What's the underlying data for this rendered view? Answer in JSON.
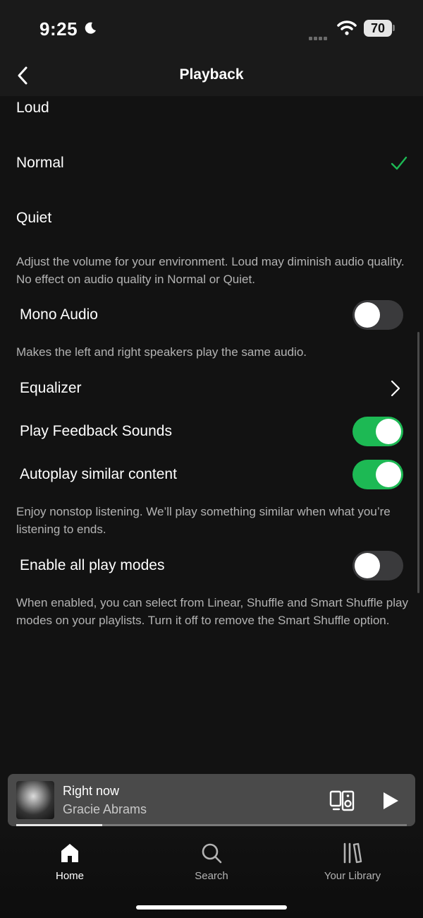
{
  "status_bar": {
    "time": "9:25",
    "battery": "70"
  },
  "header": {
    "title": "Playback"
  },
  "volume_level": {
    "options": [
      "Loud",
      "Normal",
      "Quiet"
    ],
    "selected": "Normal",
    "description": "Adjust the volume for your environment. Loud may diminish audio quality. No effect on audio quality in Normal or Quiet."
  },
  "settings": {
    "mono_audio": {
      "label": "Mono Audio",
      "enabled": false,
      "description": "Makes the left and right speakers play the same audio."
    },
    "equalizer": {
      "label": "Equalizer"
    },
    "play_feedback_sounds": {
      "label": "Play Feedback Sounds",
      "enabled": true
    },
    "autoplay": {
      "label": "Autoplay similar content",
      "enabled": true,
      "description": "Enjoy nonstop listening. We’ll play something similar when what you’re listening to ends."
    },
    "enable_all_play_modes": {
      "label": "Enable all play modes",
      "enabled": false,
      "description": "When enabled, you can select from Linear, Shuffle and Smart Shuffle play modes on your playlists. Turn it off to remove the Smart Shuffle option."
    }
  },
  "mini_player": {
    "title": "Right now",
    "artist": "Gracie Abrams",
    "progress": 0.22
  },
  "nav": {
    "home": "Home",
    "search": "Search",
    "library": "Your Library"
  },
  "colors": {
    "accent": "#1db954",
    "background": "#121212"
  }
}
